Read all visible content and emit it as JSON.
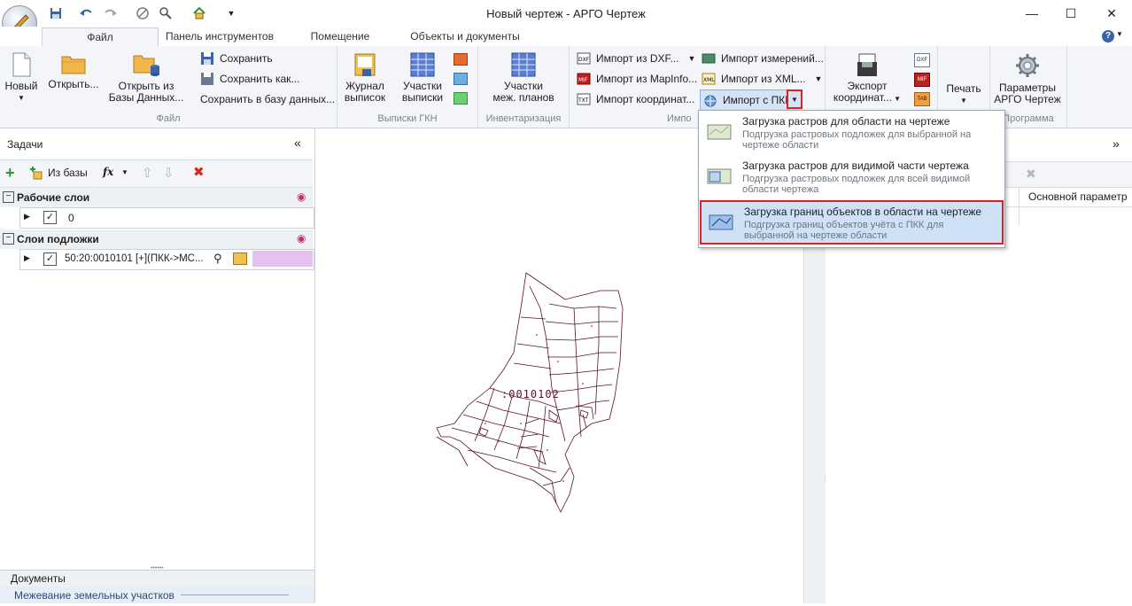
{
  "window": {
    "title": "Новый чертеж - АРГО Чертеж",
    "minimize_icon": "minimize-icon",
    "maximize_icon": "maximize-icon",
    "close_icon": "close-icon"
  },
  "quick_access": [
    "save-icon",
    "undo-icon",
    "redo-icon",
    "stop-icon",
    "search-icon",
    "home-icon",
    "dropdown-icon"
  ],
  "tabs": [
    {
      "label": "Файл",
      "active": true
    },
    {
      "label": "Панель инструментов"
    },
    {
      "label": "Помещение"
    },
    {
      "label": "Объекты и документы"
    }
  ],
  "ribbon": {
    "file_group": {
      "label": "Файл",
      "new": "Новый",
      "open": "Открыть...",
      "open_db_1": "Открыть из",
      "open_db_2": "Базы Данных...",
      "save": "Сохранить",
      "save_as": "Сохранить как...",
      "save_db": "Сохранить в базу данных..."
    },
    "gkn_group": {
      "label": "Выписки ГКН",
      "journal_1": "Журнал",
      "journal_2": "выписок",
      "parcels_1": "Участки",
      "parcels_2": "выписки"
    },
    "inv_group": {
      "label": "Инвентаризация",
      "plans_1": "Участки",
      "plans_2": "меж. планов"
    },
    "import_group": {
      "label": "Импо",
      "dxf": "Импорт из DXF...",
      "mapinfo": "Импорт из MapInfo...",
      "coords": "Импорт координат...",
      "meas": "Импорт измерений...",
      "xml": "Импорт из XML...",
      "pkk": "Импорт с ПКК"
    },
    "export_group": {
      "export_1": "Экспорт",
      "export_2": "координат..."
    },
    "print_group": {
      "print": "Печать"
    },
    "program_group": {
      "label": "Программа",
      "params_1": "Параметры",
      "params_2": "АРГО Чертеж"
    }
  },
  "dropdown": {
    "items": [
      {
        "title": "Загрузка растров для области на чертеже",
        "desc": "Подгрузка растровых подложек для выбранной на чертеже области"
      },
      {
        "title": "Загрузка растров для видимой части чертежа",
        "desc": "Подгрузка растровых подложек для всей видимой области чертежа"
      },
      {
        "title": "Загрузка границ объектов в области на чертеже",
        "desc": "Подгрузка границ объектов учёта с ПКК для выбранной на чертеже области"
      }
    ]
  },
  "left_pane": {
    "title": "Задачи",
    "from_db": "Из базы",
    "fx": "fx",
    "work_layers": "Рабочие слои",
    "work_layer_value": "0",
    "base_layers": "Слои подложки",
    "base_layer_value": "50:20:0010101 [+](ПКК->МС...",
    "documents": "Документы",
    "survey": "Межевание земельных участков"
  },
  "canvas": {
    "label": ":0010102"
  },
  "right_pane": {
    "column": "Основной параметр"
  },
  "colors": {
    "ribbon_bg": "#f3f5f8",
    "accent_red": "#e02020",
    "highlight": "#cfe1f7",
    "parcel_stroke": "#5a1030"
  }
}
